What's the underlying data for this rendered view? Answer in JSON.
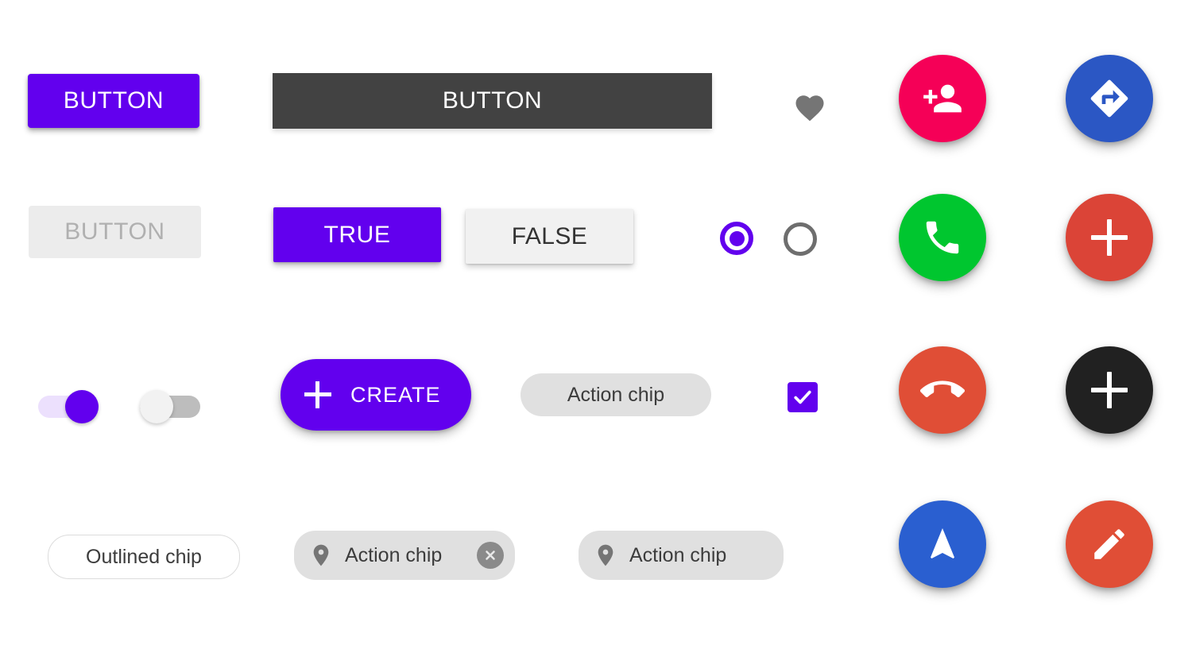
{
  "theme": {
    "primary": "#6200ee",
    "background": "#ffffff",
    "dark_bar": "#424242",
    "chip_fill": "#e0e0e0",
    "disabled_fill": "#ececec",
    "disabled_text": "#b0b0b0"
  },
  "row1": {
    "contained_button_label": "BUTTON",
    "dark_button_label": "BUTTON",
    "favorite_icon": "heart-icon",
    "fab_person_add": {
      "icon": "person-add-icon",
      "color": "#f50057"
    },
    "fab_directions": {
      "icon": "directions-icon",
      "color": "#2b57c4"
    }
  },
  "row2": {
    "disabled_button_label": "BUTTON",
    "toggle_true_label": "TRUE",
    "toggle_false_label": "FALSE",
    "radio_selected": {
      "icon": "radio-checked-icon",
      "color": "#6200ee"
    },
    "radio_unselected": {
      "icon": "radio-unchecked-icon",
      "color": "#6e6e6e"
    },
    "fab_call": {
      "icon": "phone-icon",
      "color": "#00c62f"
    },
    "fab_add_red": {
      "icon": "plus-icon",
      "color": "#db4437"
    }
  },
  "row3": {
    "switch_on": {
      "icon": "switch-on-icon",
      "state": "on"
    },
    "switch_off": {
      "icon": "switch-off-icon",
      "state": "off"
    },
    "extended_fab": {
      "label": "CREATE",
      "icon": "plus-icon"
    },
    "action_chip_label": "Action chip",
    "checkbox": {
      "icon": "check-icon",
      "state": "checked"
    },
    "fab_call_end": {
      "icon": "call-end-icon",
      "color": "#e04e36"
    },
    "fab_add_black": {
      "icon": "plus-icon",
      "color": "#212121"
    }
  },
  "row4": {
    "outlined_chip_label": "Outlined chip",
    "chip_with_close": {
      "label": "Action chip",
      "leading_icon": "location-pin-icon",
      "trailing_icon": "close-icon"
    },
    "chip_plain": {
      "label": "Action chip",
      "leading_icon": "location-pin-icon"
    },
    "fab_navigation": {
      "icon": "navigation-arrow-icon",
      "color": "#2a5fd0"
    },
    "fab_edit": {
      "icon": "pencil-icon",
      "color": "#e04e36"
    }
  }
}
